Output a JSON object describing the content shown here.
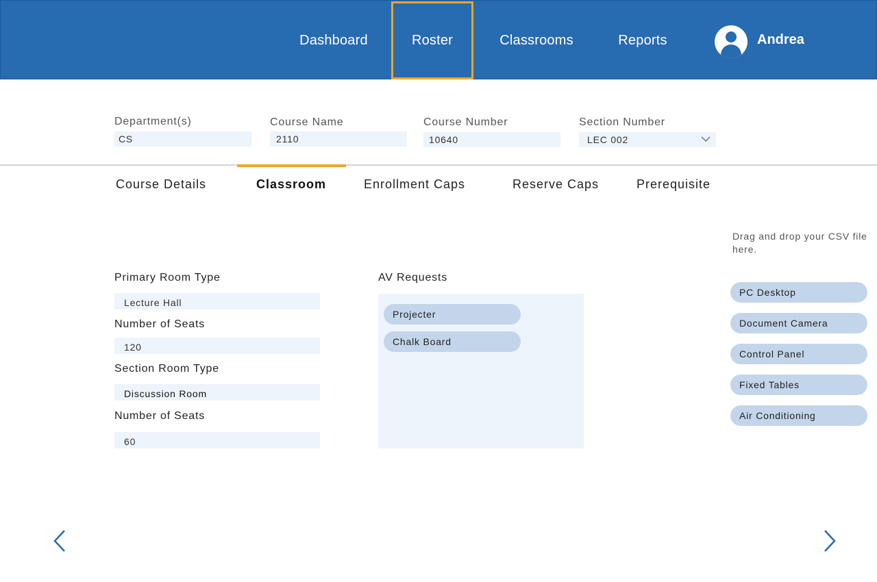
{
  "nav": {
    "items": [
      {
        "label": "Dashboard"
      },
      {
        "label": "Roster"
      },
      {
        "label": "Classrooms"
      },
      {
        "label": "Reports"
      }
    ],
    "user_name": "Andrea"
  },
  "filters": {
    "department": {
      "label": "Department(s)",
      "value": "CS"
    },
    "course_name": {
      "label": "Course Name",
      "value": "2110"
    },
    "course_number": {
      "label": "Course Number",
      "value": "10640"
    },
    "section_number": {
      "label": "Section Number",
      "value": "LEC 002"
    }
  },
  "tabs": [
    {
      "label": "Course Details"
    },
    {
      "label": "Classroom"
    },
    {
      "label": "Enrollment Caps"
    },
    {
      "label": "Reserve Caps"
    },
    {
      "label": "Prerequisite"
    }
  ],
  "form": {
    "primary_room_type": {
      "label": "Primary Room Type",
      "value": "Lecture Hall"
    },
    "primary_seats": {
      "label": "Number of Seats",
      "value": "120"
    },
    "section_room_type": {
      "label": "Section Room Type",
      "value": "Discussion Room"
    },
    "section_seats": {
      "label": "Number of Seats",
      "value": "60"
    }
  },
  "av_requests": {
    "label": "AV Requests",
    "items": [
      "Projecter",
      "Chalk Board"
    ]
  },
  "csv_hint": "Drag and drop your CSV file here.",
  "available_av": [
    "PC Desktop",
    "Document Camera",
    "Control Panel",
    "Fixed Tables",
    "Air Conditioning"
  ],
  "colors": {
    "brand": "#276bb0",
    "accent": "#f3a523",
    "field_bg": "#eef4fb",
    "pill_bg": "#c3d5ea"
  },
  "icons": {
    "prev": "chevron-left-icon",
    "next": "chevron-right-icon",
    "dropdown": "chevron-down-icon",
    "avatar": "user-avatar-icon"
  }
}
